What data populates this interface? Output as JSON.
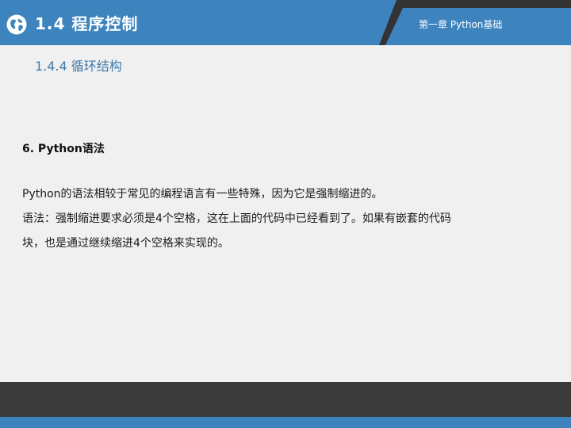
{
  "header": {
    "section_title": "1.4  程序控制",
    "chapter": "第一章 Python基础",
    "colors": {
      "blue": "#3d84bf",
      "dark": "#333333"
    }
  },
  "subsection": {
    "title": "1.4.4  循环结构"
  },
  "content": {
    "heading": "6. Python语法",
    "paragraphs": [
      "Python的语法相较于常见的编程语言有一些特殊，因为它是强制缩进的。",
      "语法：强制缩进要求必须是4个空格，这在上面的代码中已经看到了。如果有嵌套的代码",
      "块，也是通过继续缩进4个空格来实现的。"
    ]
  },
  "icons": {
    "globe": "globe-icon"
  }
}
